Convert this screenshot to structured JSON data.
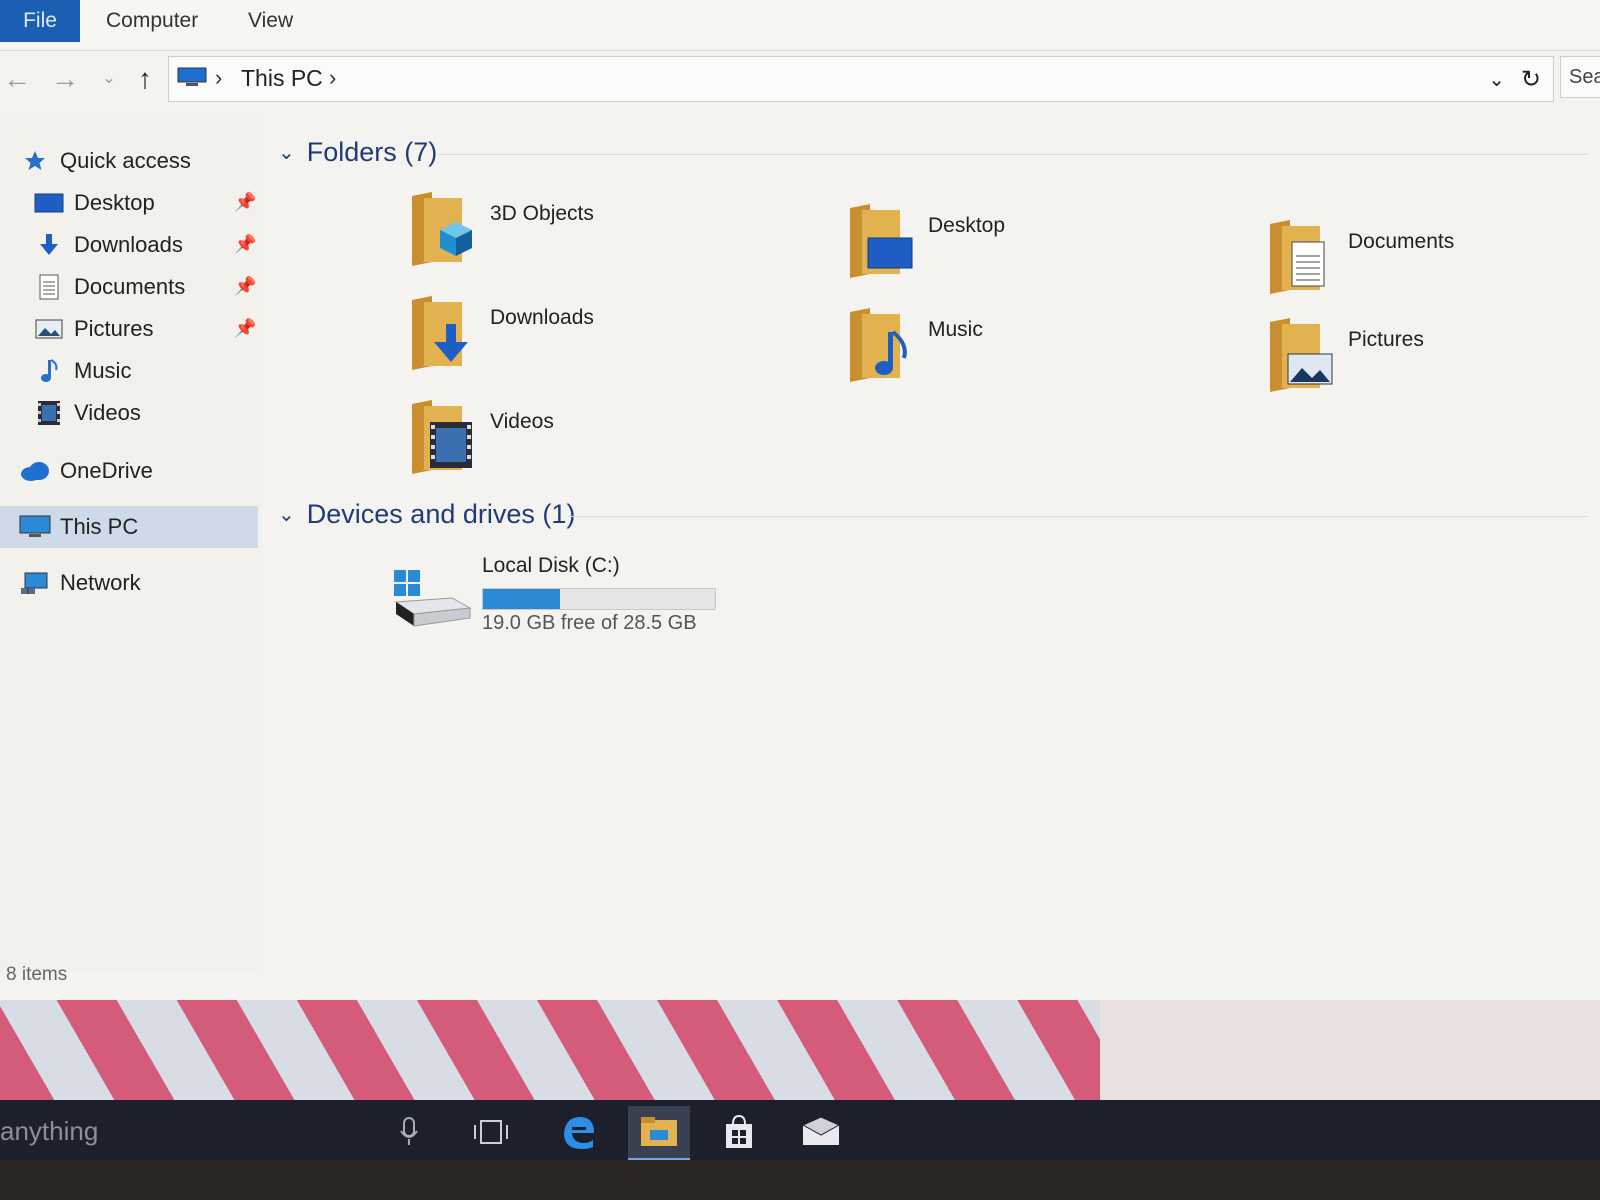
{
  "ribbon": {
    "tabs": [
      "File",
      "Computer",
      "View"
    ]
  },
  "nav": {
    "back_icon": "arrow-left-icon",
    "forward_icon": "arrow-right-icon",
    "recent_icon": "chevron-down-icon",
    "up_icon": "arrow-up-icon",
    "breadcrumb": [
      "This PC"
    ],
    "search_placeholder": "Sea"
  },
  "sidebar": {
    "items": [
      {
        "label": "Quick access",
        "icon": "star-icon",
        "pinned": false
      },
      {
        "label": "Desktop",
        "icon": "desktop-icon",
        "pinned": true
      },
      {
        "label": "Downloads",
        "icon": "download-icon",
        "pinned": true
      },
      {
        "label": "Documents",
        "icon": "document-icon",
        "pinned": true
      },
      {
        "label": "Pictures",
        "icon": "pictures-icon",
        "pinned": true
      },
      {
        "label": "Music",
        "icon": "music-icon",
        "pinned": false
      },
      {
        "label": "Videos",
        "icon": "video-icon",
        "pinned": false
      },
      {
        "label": "OneDrive",
        "icon": "cloud-icon",
        "pinned": false
      },
      {
        "label": "This PC",
        "icon": "computer-icon",
        "pinned": false,
        "selected": true
      },
      {
        "label": "Network",
        "icon": "network-icon",
        "pinned": false
      }
    ]
  },
  "main": {
    "folders_header": "Folders (7)",
    "folders": [
      {
        "name": "3D Objects",
        "icon": "cube-icon"
      },
      {
        "name": "Desktop",
        "icon": "desktop-icon"
      },
      {
        "name": "Documents",
        "icon": "document-icon"
      },
      {
        "name": "Downloads",
        "icon": "download-icon"
      },
      {
        "name": "Music",
        "icon": "music-icon"
      },
      {
        "name": "Pictures",
        "icon": "pictures-icon"
      },
      {
        "name": "Videos",
        "icon": "video-icon"
      }
    ],
    "drives_header": "Devices and drives (1)",
    "drive": {
      "name": "Local Disk (C:)",
      "free_text": "19.0 GB free of 28.5 GB",
      "used_fraction": 0.33
    }
  },
  "status": {
    "text": "8 items"
  },
  "taskbar": {
    "search_text": "anything",
    "buttons": [
      "microphone-icon",
      "task-view-icon",
      "edge-icon",
      "file-explorer-icon",
      "store-icon",
      "mail-icon"
    ]
  },
  "colors": {
    "accent": "#1a5fb4",
    "folder": "#d9a441",
    "header_text": "#1e3d78",
    "progress": "#2a8ad6"
  }
}
